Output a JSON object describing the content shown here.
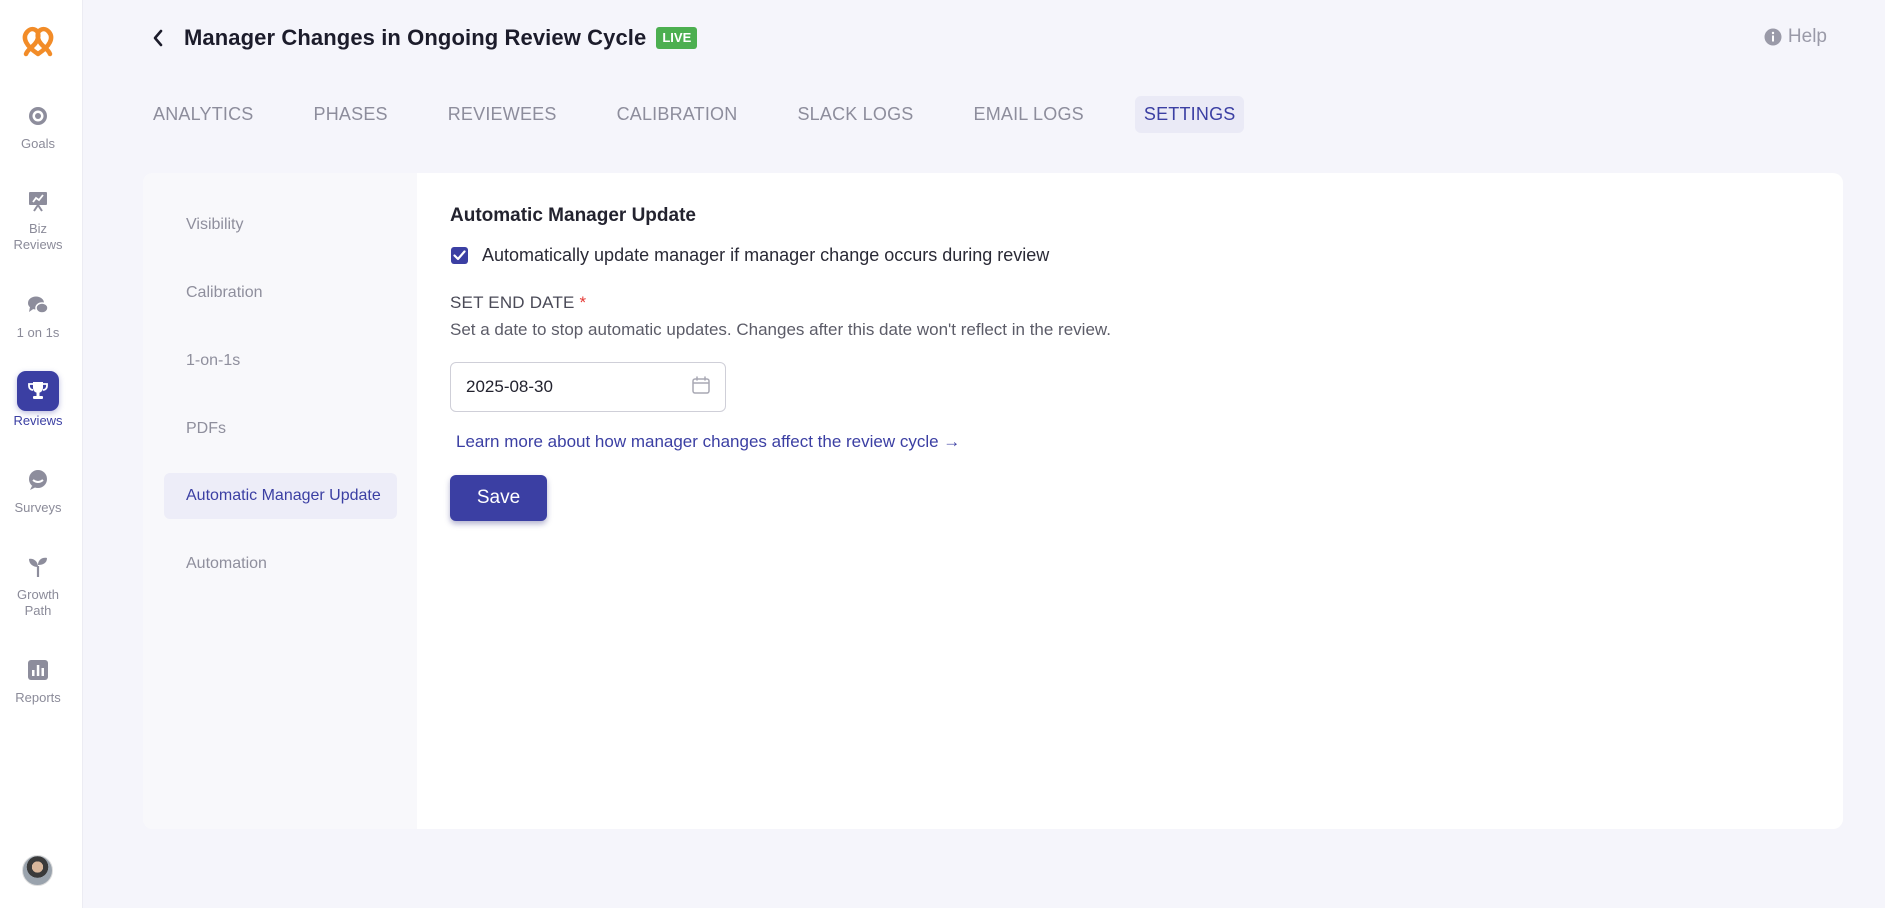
{
  "colors": {
    "accent": "#3b3fa3",
    "live": "#4caf50",
    "logo": "#f28c28",
    "required": "#e53935"
  },
  "nav": {
    "logo_icon": "pretzel-logo-icon",
    "items": [
      {
        "label": "Goals",
        "icon": "target-icon"
      },
      {
        "label": "Biz\nReviews",
        "icon": "presentation-chart-icon"
      },
      {
        "label": "1 on 1s",
        "icon": "chat-bubbles-icon"
      },
      {
        "label": "Reviews",
        "icon": "trophy-icon",
        "active": true
      },
      {
        "label": "Surveys",
        "icon": "survey-bubble-icon"
      },
      {
        "label": "Growth\nPath",
        "icon": "sprout-icon"
      },
      {
        "label": "Reports",
        "icon": "bar-chart-icon"
      }
    ],
    "avatar_icon": "user-avatar"
  },
  "header": {
    "title": "Manager Changes in Ongoing Review Cycle",
    "badge": "LIVE",
    "help": "Help"
  },
  "tabs": [
    {
      "label": "ANALYTICS"
    },
    {
      "label": "PHASES"
    },
    {
      "label": "REVIEWEES"
    },
    {
      "label": "CALIBRATION"
    },
    {
      "label": "SLACK LOGS"
    },
    {
      "label": "EMAIL LOGS"
    },
    {
      "label": "SETTINGS",
      "active": true
    }
  ],
  "settings_menu": [
    {
      "label": "Visibility"
    },
    {
      "label": "Calibration"
    },
    {
      "label": "1-on-1s"
    },
    {
      "label": "PDFs"
    },
    {
      "label": "Automatic Manager Update",
      "active": true
    },
    {
      "label": "Automation"
    }
  ],
  "content": {
    "section_title": "Automatic Manager Update",
    "checkbox_label": "Automatically update manager if manager change occurs during review",
    "checkbox_checked": true,
    "end_date_label": "SET END DATE",
    "required_mark": "*",
    "end_date_help": "Set a date to stop automatic updates. Changes after this date won't reflect in the review.",
    "end_date_value": "2025-08-30",
    "learn_more": "Learn more about how manager changes affect the review cycle →",
    "save": "Save"
  }
}
